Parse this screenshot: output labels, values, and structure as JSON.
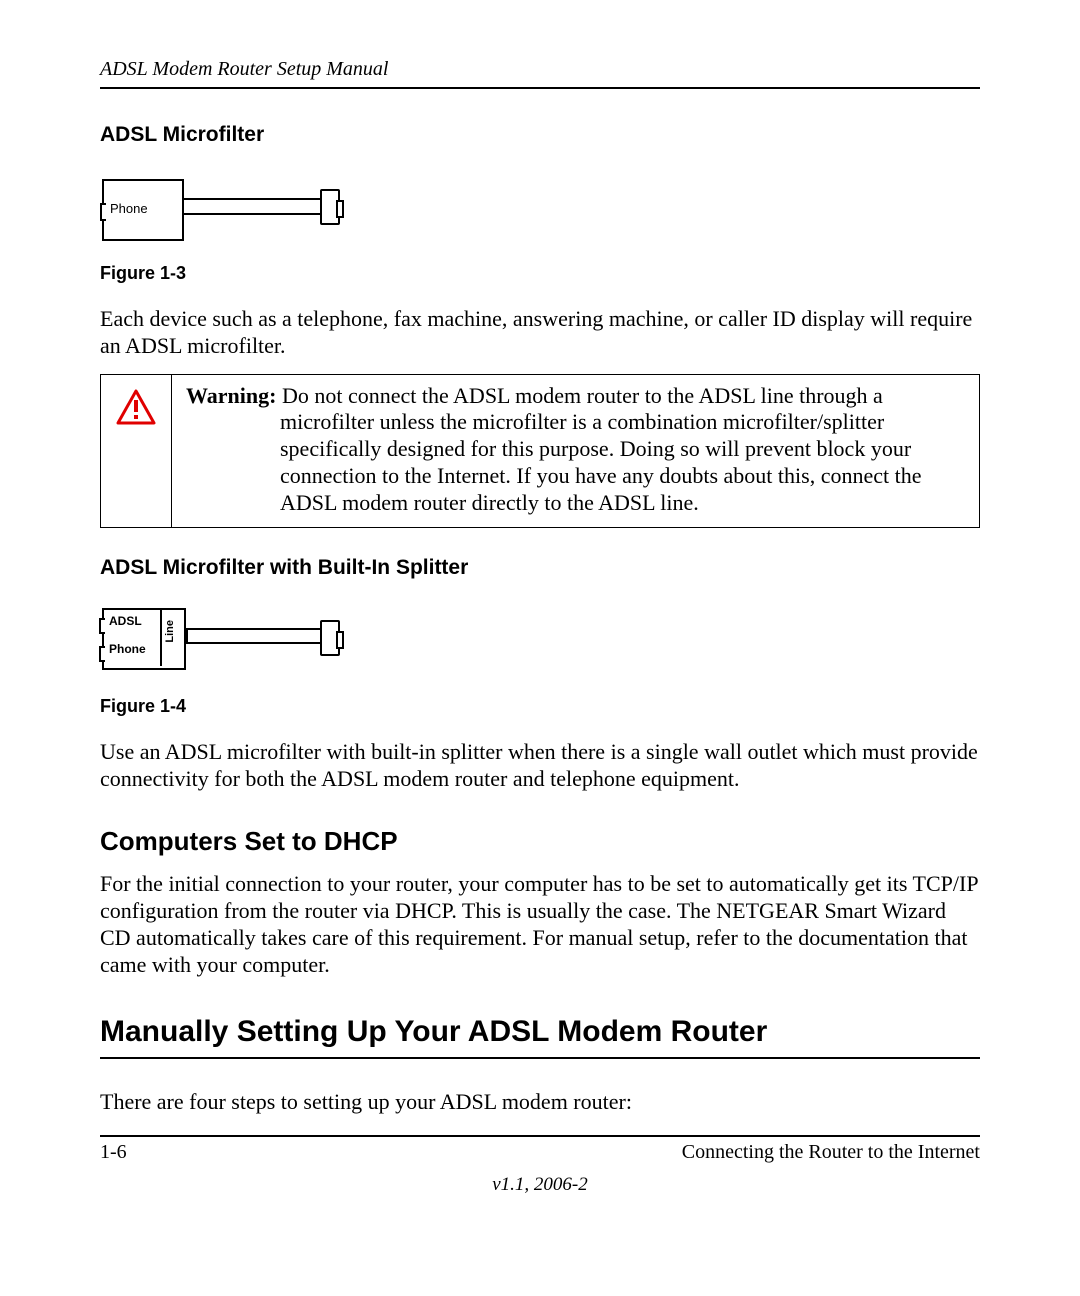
{
  "header": {
    "running_title": "ADSL Modem Router Setup Manual"
  },
  "section1": {
    "title": "ADSL Microfilter",
    "fig_label_phone": "Phone",
    "fig_caption": "Figure 1-3",
    "para": "Each device such as a telephone, fax machine, answering machine, or caller ID display will require an ADSL microfilter."
  },
  "warning": {
    "label": "Warning:",
    "text": "Do not connect the ADSL modem router to the ADSL line through a microfilter unless the microfilter is a combination microfilter/splitter specifically designed for this purpose. Doing so will prevent block your connection to the Internet. If you have any doubts about this, connect the ADSL modem router directly to the ADSL line."
  },
  "section2": {
    "title": "ADSL Microfilter with Built-In Splitter",
    "fig_label_adsl": "ADSL",
    "fig_label_phone": "Phone",
    "fig_label_line": "Line",
    "fig_caption": "Figure 1-4",
    "para": "Use an ADSL microfilter with built-in splitter when there is a single wall outlet which must provide connectivity for both the ADSL modem router and telephone equipment."
  },
  "section3": {
    "title": "Computers Set to DHCP",
    "para": "For the initial connection to your router, your computer has to be set to automatically get its TCP/IP configuration from the router via DHCP. This is usually the case. The NETGEAR Smart Wizard CD automatically takes care of this requirement. For manual setup, refer to the documentation that came with your computer."
  },
  "section4": {
    "title": "Manually Setting Up Your ADSL Modem Router",
    "para": "There are four steps to setting up your ADSL modem router:"
  },
  "footer": {
    "page_num": "1-6",
    "chapter": "Connecting the Router to the Internet",
    "version": "v1.1, 2006-2"
  }
}
